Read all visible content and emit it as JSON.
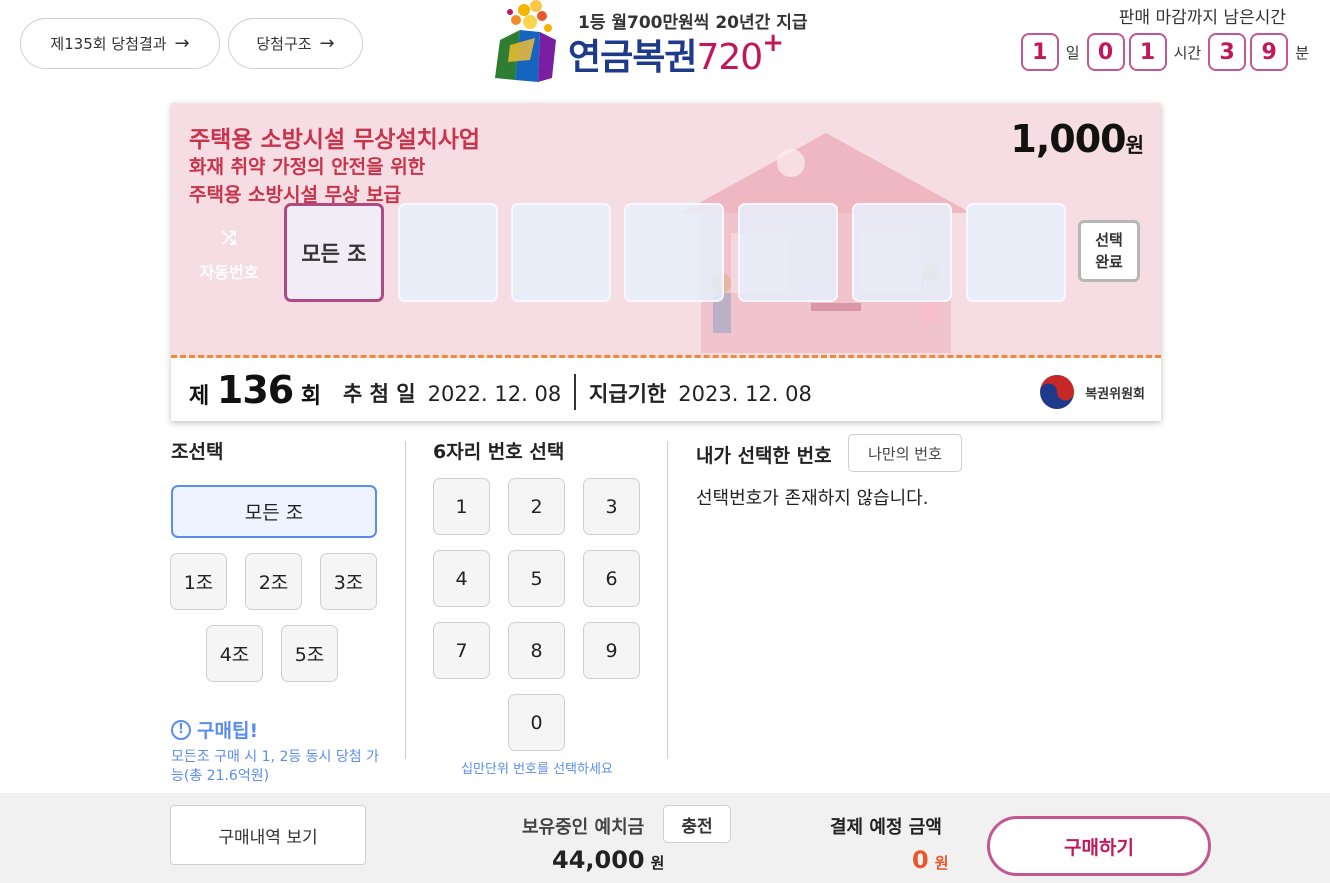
{
  "header": {
    "result_button": "제135회 당첨결과",
    "structure_button": "당첨구조",
    "arrow": "→",
    "logo_subtitle": "1등 월700만원씩 20년간 지급",
    "logo_title": "연금복권",
    "logo_number": "720",
    "logo_plus": "+",
    "timer_label": "판매 마감까지 남은시간",
    "timer": {
      "day": "1",
      "day_unit": "일",
      "hour_1": "0",
      "hour_2": "1",
      "hour_unit": "시간",
      "min_1": "3",
      "min_2": "9",
      "min_unit": "분"
    }
  },
  "ticket": {
    "title": "주택용 소방시설 무상설치사업",
    "subtitle_1": "화재 취약 가정의 안전을 위한",
    "subtitle_2": "주택용 소방시설 무상 보급",
    "price": "1,000",
    "price_unit": "원",
    "auto_label": "자동번호",
    "auto_icon": "shuffle-icon",
    "group_slot": "모든 조",
    "select_done_1": "선택",
    "select_done_2": "완료",
    "round_prefix": "제",
    "round_number": "136",
    "round_suffix": "회",
    "draw_label": "추 첨 일",
    "draw_date": "2022. 12. 08",
    "pay_label": "지급기한",
    "pay_date": "2023. 12. 08",
    "committee": "복권위원회"
  },
  "group_section": {
    "title": "조선택",
    "all": "모든 조",
    "groups": [
      "1조",
      "2조",
      "3조",
      "4조",
      "5조"
    ],
    "tip_title": "구매팁!",
    "tip_icon": "!",
    "tip_text": "모든조 구매 시 1, 2등 동시 당첨 가능(총 21.6억원)"
  },
  "number_section": {
    "title": "6자리 번호 선택",
    "numbers": [
      "1",
      "2",
      "3",
      "4",
      "5",
      "6",
      "7",
      "8",
      "9",
      "0"
    ],
    "hint": "십만단위 번호를 선택하세요"
  },
  "my_section": {
    "title": "내가 선택한 번호",
    "my_button": "나만의 번호",
    "empty": "선택번호가 존재하지 않습니다."
  },
  "footer": {
    "history_button": "구매내역 보기",
    "deposit_label": "보유중인 예치금",
    "charge_button": "충전",
    "deposit_amount": "44,000",
    "won": "원",
    "payment_label": "결제 예정 금액",
    "payment_amount": "0",
    "buy_button": "구매하기"
  },
  "colors": {
    "accent": "#c2185b",
    "blue": "#5b8def",
    "ticket_bg": "#f6dce3",
    "orange": "#e8582f"
  }
}
